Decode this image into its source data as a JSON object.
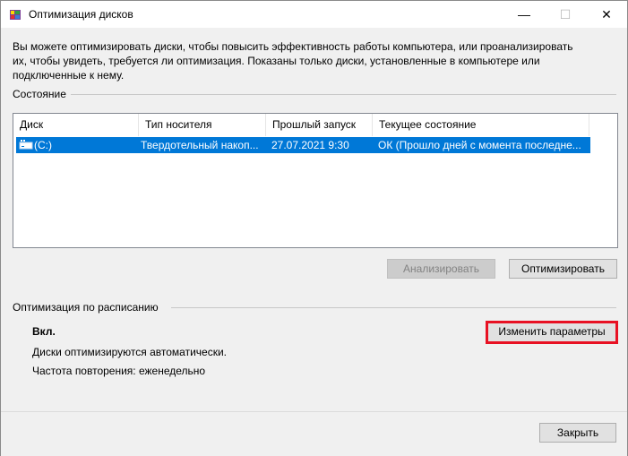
{
  "window": {
    "title": "Оптимизация дисков",
    "minimize": "—",
    "maximize": "☐",
    "close": "✕"
  },
  "description": "Вы можете оптимизировать диски, чтобы повысить эффективность работы  компьютера, или проанализировать их, чтобы увидеть, требуется ли оптимизация. Показаны только диски, установленные в компьютере или подключенные к нему.",
  "status": {
    "label": "Состояние",
    "columns": [
      "Диск",
      "Тип носителя",
      "Прошлый запуск",
      "Текущее состояние"
    ],
    "rows": [
      {
        "disk": "(C:)",
        "media": "Твердотельный накоп...",
        "last_run": "27.07.2021 9:30",
        "state": "ОК (Прошло дней с момента последне..."
      }
    ],
    "selected_row": 0
  },
  "buttons": {
    "analyze": "Анализировать",
    "optimize": "Оптимизировать",
    "change_settings": "Изменить параметры",
    "close": "Закрыть"
  },
  "schedule": {
    "label": "Оптимизация по расписанию",
    "status": "Вкл.",
    "auto_text": "Диски оптимизируются автоматически.",
    "frequency": "Частота повторения: еженедельно"
  },
  "colors": {
    "selection": "#0078d7",
    "highlight_border": "#e81123"
  },
  "icons": [
    "defrag-app-icon",
    "drive-icon"
  ]
}
